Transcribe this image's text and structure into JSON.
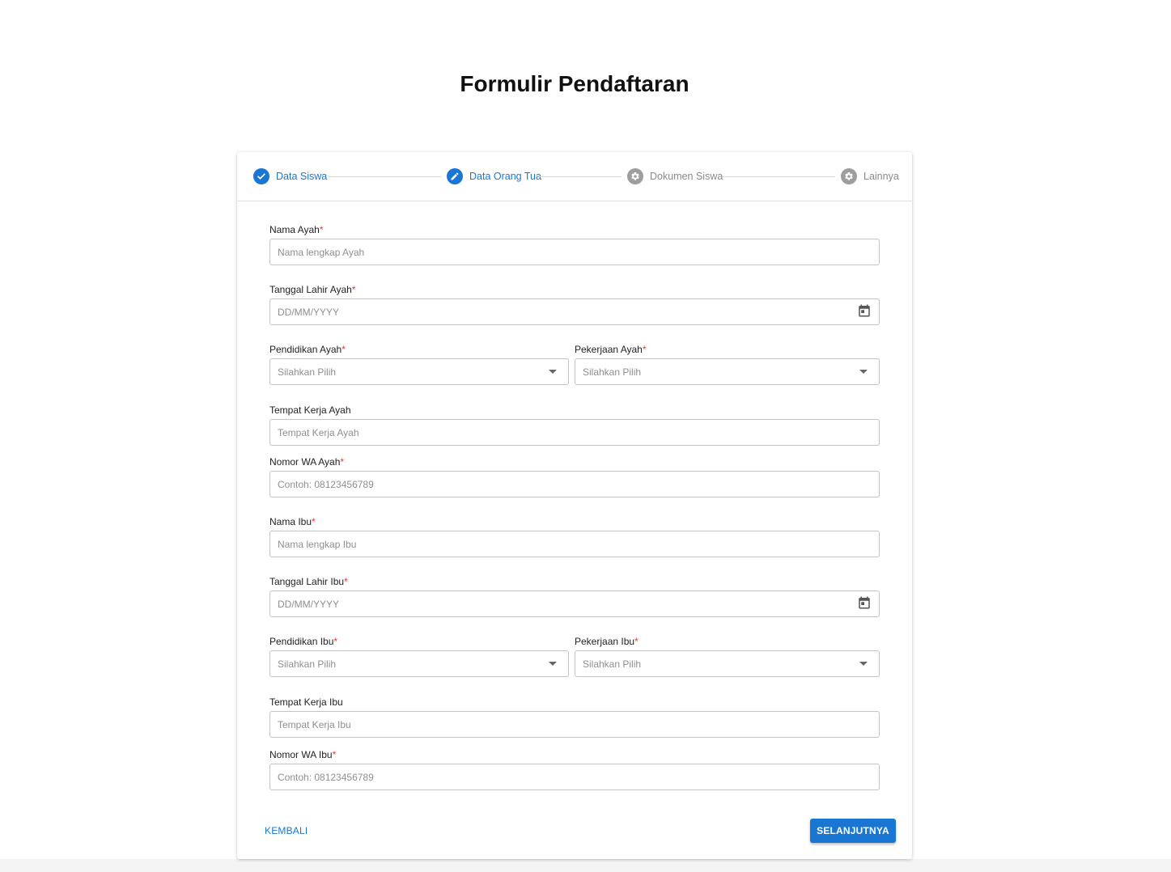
{
  "page": {
    "title": "Formulir Pendaftaran"
  },
  "stepper": {
    "steps": [
      {
        "label": "Data Siswa",
        "state": "completed",
        "icon": "check-icon"
      },
      {
        "label": "Data Orang Tua",
        "state": "editing",
        "icon": "pencil-icon"
      },
      {
        "label": "Dokumen Siswa",
        "state": "inactive",
        "icon": "gear-icon"
      },
      {
        "label": "Lainnya",
        "state": "inactive",
        "icon": "gear-icon"
      }
    ]
  },
  "form": {
    "required_mark": "*",
    "nama_ayah": {
      "label": "Nama Ayah",
      "placeholder": "Nama lengkap Ayah",
      "required": true
    },
    "tanggal_lahir_ayah": {
      "label": "Tanggal Lahir Ayah",
      "placeholder": "DD/MM/YYYY",
      "required": true,
      "icon": "calendar-icon"
    },
    "pendidikan_ayah": {
      "label": "Pendidikan Ayah",
      "value": "Silahkan Pilih",
      "required": true
    },
    "pekerjaan_ayah": {
      "label": "Pekerjaan Ayah",
      "value": "Silahkan Pilih",
      "required": true
    },
    "tempat_kerja_ayah": {
      "label": "Tempat Kerja Ayah",
      "placeholder": "Tempat Kerja Ayah",
      "required": false
    },
    "nomor_wa_ayah": {
      "label": "Nomor WA Ayah",
      "placeholder": "Contoh: 08123456789",
      "required": true
    },
    "nama_ibu": {
      "label": "Nama Ibu",
      "placeholder": "Nama lengkap Ibu",
      "required": true
    },
    "tanggal_lahir_ibu": {
      "label": "Tanggal Lahir Ibu",
      "placeholder": "DD/MM/YYYY",
      "required": true,
      "icon": "calendar-icon"
    },
    "pendidikan_ibu": {
      "label": "Pendidikan Ibu",
      "value": "Silahkan Pilih",
      "required": true
    },
    "pekerjaan_ibu": {
      "label": "Pekerjaan Ibu",
      "value": "Silahkan Pilih",
      "required": true
    },
    "tempat_kerja_ibu": {
      "label": "Tempat Kerja Ibu",
      "placeholder": "Tempat Kerja Ibu",
      "required": false
    },
    "nomor_wa_ibu": {
      "label": "Nomor WA Ibu",
      "placeholder": "Contoh: 08123456789",
      "required": true
    }
  },
  "actions": {
    "back_label": "KEMBALI",
    "next_label": "SELANJUTNYA"
  },
  "colors": {
    "primary": "#1976d2",
    "required": "#e53935",
    "inactive": "#9e9e9e"
  }
}
